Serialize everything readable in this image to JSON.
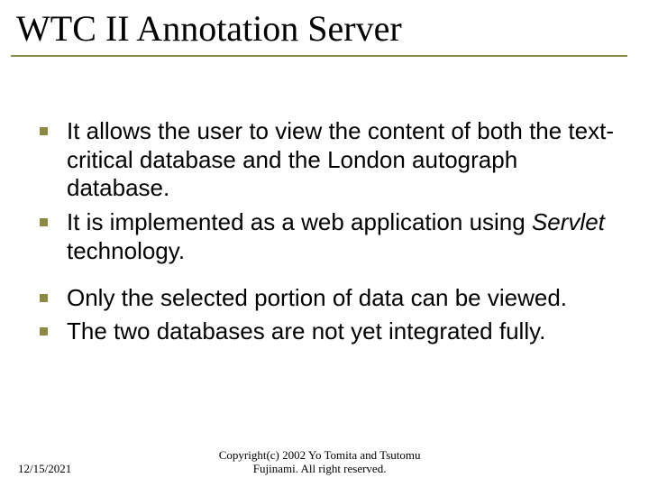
{
  "title": "WTC II Annotation Server",
  "bullets": [
    {
      "text": "It allows the user to view the content of both the text-critical database and the London autograph database."
    },
    {
      "text_pre": "It is implemented as a web application using ",
      "italic": "Servlet",
      "text_post": " technology."
    },
    {
      "text": "Only the selected portion of data can be viewed."
    },
    {
      "text": "The two databases are not yet integrated fully."
    }
  ],
  "footer": {
    "date": "12/15/2021",
    "copyright_line1": "Copyright(c) 2002 Yo Tomita and Tsutomu",
    "copyright_line2": "Fujinami. All right reserved."
  }
}
